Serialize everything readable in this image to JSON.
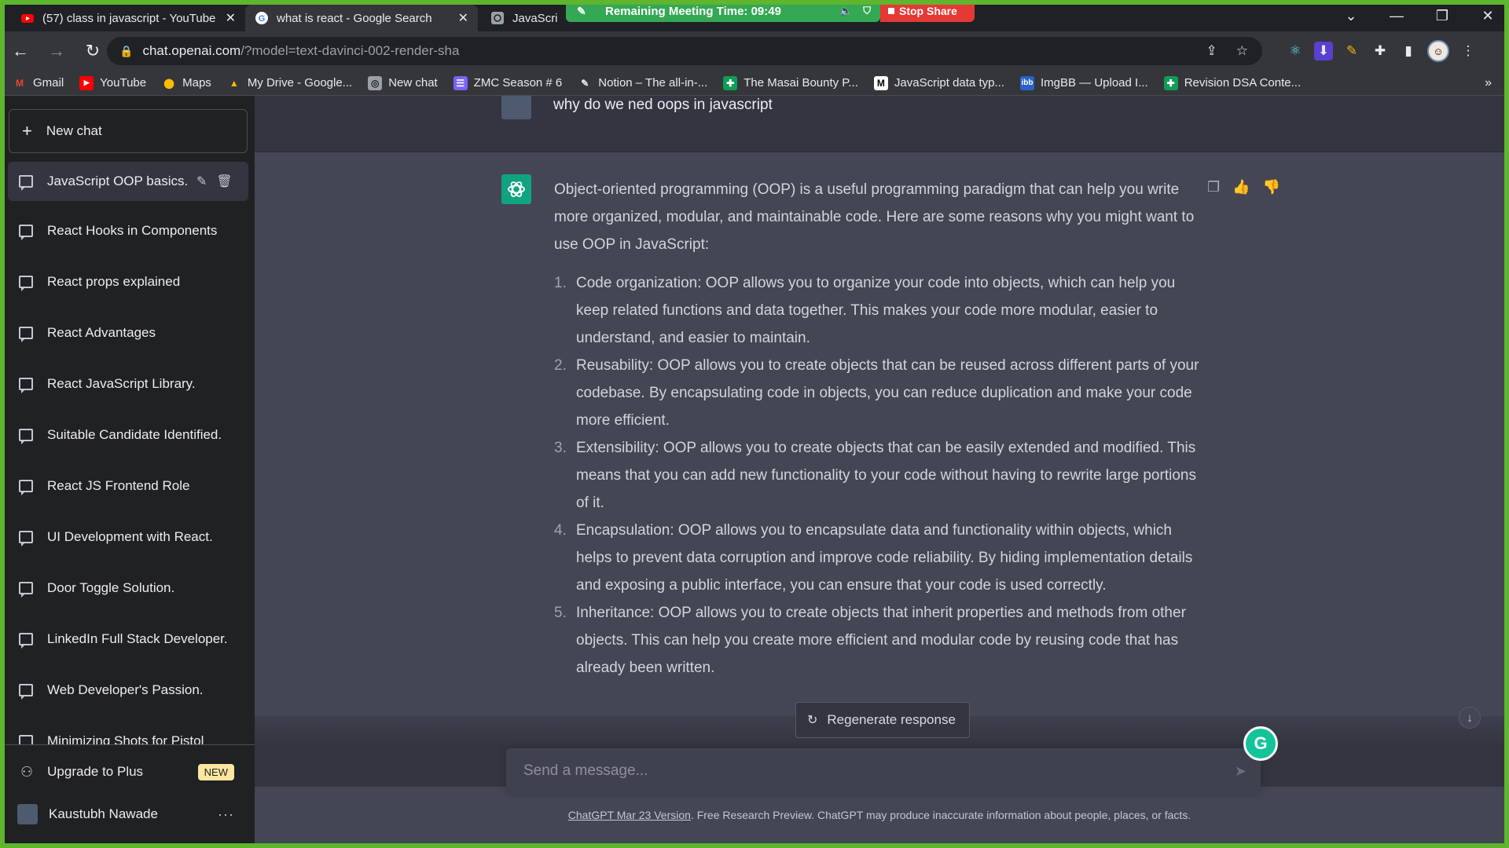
{
  "browser": {
    "tabs": [
      {
        "title": "(57) class in javascript - YouTube"
      },
      {
        "title": "what is react - Google Search"
      },
      {
        "title": "JavaScript"
      }
    ],
    "meeting_banner": "Remaining Meeting Time: 09:49",
    "stop_share": "Stop Share",
    "url_host": "chat.openai.com",
    "url_rest": "/?model=text-davinci-002-render-sha",
    "bookmarks": [
      {
        "label": "Gmail"
      },
      {
        "label": "YouTube"
      },
      {
        "label": "Maps"
      },
      {
        "label": "My Drive - Google..."
      },
      {
        "label": "New chat"
      },
      {
        "label": "ZMC Season # 6"
      },
      {
        "label": "Notion – The all-in-..."
      },
      {
        "label": "The Masai Bounty P..."
      },
      {
        "label": "JavaScript data typ..."
      },
      {
        "label": "ImgBB — Upload I..."
      },
      {
        "label": "Revision DSA Conte..."
      }
    ]
  },
  "sidebar": {
    "new_chat": "New chat",
    "conversations": [
      {
        "label": "JavaScript OOP basics."
      },
      {
        "label": "React Hooks in Components"
      },
      {
        "label": "React props explained"
      },
      {
        "label": "React Advantages"
      },
      {
        "label": "React JavaScript Library."
      },
      {
        "label": "Suitable Candidate Identified."
      },
      {
        "label": "React JS Frontend Role"
      },
      {
        "label": "UI Development with React."
      },
      {
        "label": "Door Toggle Solution."
      },
      {
        "label": "LinkedIn Full Stack Developer."
      },
      {
        "label": "Web Developer's Passion."
      },
      {
        "label": "Minimizing Shots for Pistol"
      }
    ],
    "upgrade": "Upgrade to Plus",
    "new_badge": "NEW",
    "user_name": "Kaustubh Nawade"
  },
  "chat": {
    "user_message": "why do we ned oops in javascript",
    "intro": "Object-oriented programming (OOP) is a useful programming paradigm that can help you write more organized, modular, and maintainable code. Here are some reasons why you might want to use OOP in JavaScript:",
    "points": [
      {
        "num": "1.",
        "text": "Code organization: OOP allows you to organize your code into objects, which can help you keep related functions and data together. This makes your code more modular, easier to understand, and easier to maintain."
      },
      {
        "num": "2.",
        "text": "Reusability: OOP allows you to create objects that can be reused across different parts of your codebase. By encapsulating code in objects, you can reduce duplication and make your code more efficient."
      },
      {
        "num": "3.",
        "text": "Extensibility: OOP allows you to create objects that can be easily extended and modified. This means that you can add new functionality to your code without having to rewrite large portions of it."
      },
      {
        "num": "4.",
        "text": "Encapsulation: OOP allows you to encapsulate data and functionality within objects, which helps to prevent data corruption and improve code reliability. By hiding implementation details and exposing a public interface, you can ensure that your code is used correctly."
      },
      {
        "num": "5.",
        "text": "Inheritance: OOP allows you to create objects that inherit properties and methods from other objects. This can help you create more efficient and modular code by reusing code that has already been written."
      }
    ],
    "regenerate": "Regenerate response",
    "composer_placeholder": "Send a message...",
    "footer_link": "ChatGPT Mar 23 Version",
    "footer_text": ". Free Research Preview. ChatGPT may produce inaccurate information about people, places, or facts."
  },
  "colors": {
    "frame": "#5fb52e",
    "meeting_green": "#34a853",
    "stop_red": "#e53935",
    "gpt_green": "#10a37f",
    "sidebar_bg": "#202123",
    "main_bg": "#343541",
    "answer_bg": "#444654"
  },
  "icons": [
    "youtube-icon",
    "google-icon",
    "chatgpt-icon",
    "mic-icon",
    "shield-icon",
    "back-icon",
    "forward-icon",
    "reload-icon",
    "lock-icon",
    "share-icon",
    "star-icon",
    "puzzle-icon",
    "sidebar-icon",
    "menu-icon",
    "plus-icon",
    "chat-icon",
    "edit-icon",
    "trash-icon",
    "user-icon",
    "copy-icon",
    "thumbs-up-icon",
    "thumbs-down-icon",
    "refresh-icon",
    "arrow-down-icon",
    "send-icon",
    "grammarly-icon"
  ]
}
